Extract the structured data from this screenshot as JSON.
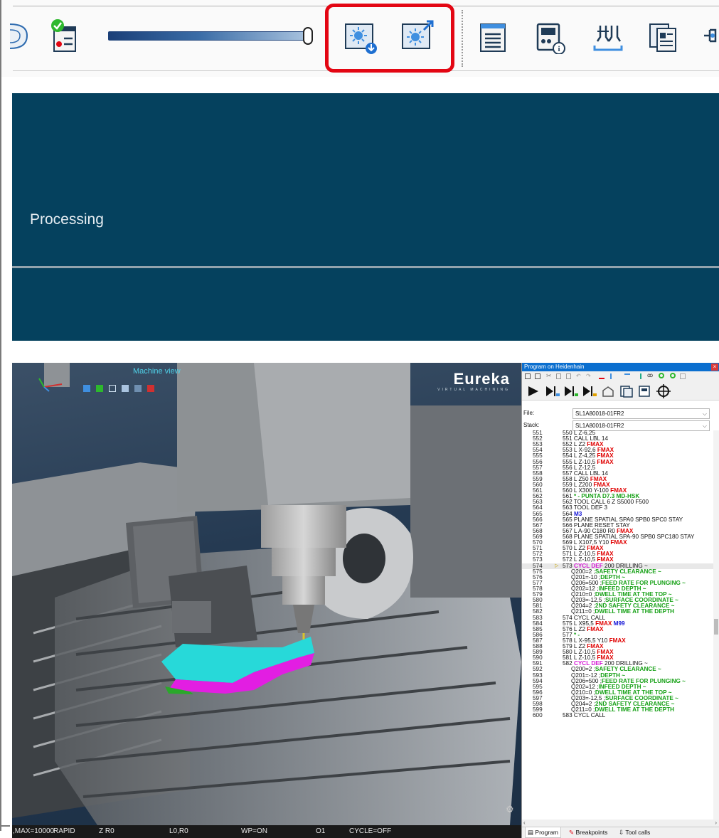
{
  "toolbar": {
    "icons": [
      "disc-icon",
      "report-check-icon",
      "light-download-icon",
      "light-export-icon",
      "document-list-icon",
      "machine-info-icon",
      "collision-icon",
      "pages-icon",
      "tool-icon"
    ],
    "slider_level": 0.97
  },
  "processing": {
    "label": "Processing"
  },
  "viewport": {
    "title": "Machine view",
    "logo": "Eureka",
    "logo_sub": "VIRTUAL MACHINING"
  },
  "status": {
    "fields": [
      ",MAX=10000",
      "RAPID",
      "Z R0",
      "L0,R0",
      "WP=ON",
      "O1",
      "CYCLE=OFF"
    ]
  },
  "program": {
    "title": "Program on Heidenhain",
    "file_label": "File:",
    "file_value": "SL1A80018-01FR2",
    "stack_label": "Stack:",
    "stack_value": "SL1A80018-01FR2",
    "tabs": [
      "Program",
      "Breakpoints",
      "Tool calls"
    ],
    "lines": [
      {
        "n": "551",
        "t": "550 L Z-6,25"
      },
      {
        "n": "552",
        "t": "551 CALL LBL 14"
      },
      {
        "n": "553",
        "t": "552 L Z2 ",
        "k": "FMAX",
        "kc": "red"
      },
      {
        "n": "554",
        "t": "553 L X-92,6 ",
        "k": "FMAX",
        "kc": "red"
      },
      {
        "n": "555",
        "t": "554 L Z-4,25 ",
        "k": "FMAX",
        "kc": "red"
      },
      {
        "n": "556",
        "t": "555 L Z-10,5 ",
        "k": "FMAX",
        "kc": "red"
      },
      {
        "n": "557",
        "t": "556 L Z-12,5"
      },
      {
        "n": "558",
        "t": "557 CALL LBL 14"
      },
      {
        "n": "559",
        "t": "558 L Z50 ",
        "k": "FMAX",
        "kc": "red"
      },
      {
        "n": "560",
        "t": "559 L Z200 ",
        "k": "FMAX",
        "kc": "red"
      },
      {
        "n": "561",
        "t": "560 L X300 Y-100 ",
        "k": "FMAX",
        "kc": "red"
      },
      {
        "n": "562",
        "t": "561 ",
        "k": "* - PUNTA D7.3 MD-HSK",
        "kc": "green"
      },
      {
        "n": "563",
        "t": "562 TOOL CALL 6 Z S5000 F500"
      },
      {
        "n": "564",
        "t": "563 TOOL DEF 3"
      },
      {
        "n": "565",
        "t": "564 ",
        "k": "M3",
        "kc": "blue"
      },
      {
        "n": "566",
        "t": "565 PLANE SPATIAL SPA0 SPB0 SPC0 STAY"
      },
      {
        "n": "567",
        "t": "566 PLANE RESET STAY"
      },
      {
        "n": "568",
        "t": "567 L A-90 C180 R0 ",
        "k": "FMAX",
        "kc": "red"
      },
      {
        "n": "569",
        "t": "568 PLANE SPATIAL SPA-90 SPB0 SPC180 STAY"
      },
      {
        "n": "570",
        "t": "569 L X107,5 Y10 ",
        "k": "FMAX",
        "kc": "red"
      },
      {
        "n": "571",
        "t": "570 L Z2 ",
        "k": "FMAX",
        "kc": "red"
      },
      {
        "n": "572",
        "t": "571 L Z-10,5 ",
        "k": "FMAX",
        "kc": "red"
      },
      {
        "n": "573",
        "t": "572 L Z-10,5 ",
        "k": "FMAX",
        "kc": "red"
      },
      {
        "n": "574",
        "t": "573 ",
        "k": "CYCL DEF",
        "kc": "mag",
        "t2": " 200 DRILLING ~",
        "cur": true
      },
      {
        "n": "575",
        "t": "Q200=2 ;",
        "k": "SAFETY CLEARANCE ~",
        "kc": "green",
        "ind": true
      },
      {
        "n": "576",
        "t": "Q201=-10 ;",
        "k": "DEPTH ~",
        "kc": "green",
        "ind": true
      },
      {
        "n": "577",
        "t": "Q206=500 ;",
        "k": "FEED RATE FOR PLUNGING ~",
        "kc": "green",
        "ind": true
      },
      {
        "n": "578",
        "t": "Q202=12 ;",
        "k": "INFEED DEPTH ~",
        "kc": "green",
        "ind": true
      },
      {
        "n": "579",
        "t": "Q210=0 ;",
        "k": "DWELL TIME AT THE TOP ~",
        "kc": "green",
        "ind": true
      },
      {
        "n": "580",
        "t": "Q203=-12,5 ;",
        "k": "SURFACE COORDINATE ~",
        "kc": "green",
        "ind": true
      },
      {
        "n": "581",
        "t": "Q204=2 ;",
        "k": "2ND SAFETY CLEARANCE ~",
        "kc": "green",
        "ind": true
      },
      {
        "n": "582",
        "t": "Q211=0 ;",
        "k": "DWELL TIME AT THE DEPTH",
        "kc": "green",
        "ind": true
      },
      {
        "n": "583",
        "t": "574 CYCL CALL"
      },
      {
        "n": "584",
        "t": "575 L X95,5 ",
        "k": "FMAX",
        "kc": "red",
        "t2": " ",
        "k2": "M99",
        "kc2": "blue"
      },
      {
        "n": "585",
        "t": "576 L Z2 ",
        "k": "FMAX",
        "kc": "red"
      },
      {
        "n": "586",
        "t": "577 ",
        "k": "* - ",
        "kc": "green"
      },
      {
        "n": "587",
        "t": "578 L X-95,5 Y10 ",
        "k": "FMAX",
        "kc": "red"
      },
      {
        "n": "588",
        "t": "579 L Z2 ",
        "k": "FMAX",
        "kc": "red"
      },
      {
        "n": "589",
        "t": "580 L Z-10,5 ",
        "k": "FMAX",
        "kc": "red"
      },
      {
        "n": "590",
        "t": "581 L Z-10,5 ",
        "k": "FMAX",
        "kc": "red"
      },
      {
        "n": "591",
        "t": "582 ",
        "k": "CYCL DEF",
        "kc": "mag",
        "t2": " 200 DRILLING ~"
      },
      {
        "n": "592",
        "t": "Q200=2 ;",
        "k": "SAFETY CLEARANCE ~",
        "kc": "green",
        "ind": true
      },
      {
        "n": "593",
        "t": "Q201=-12 ;",
        "k": "DEPTH ~",
        "kc": "green",
        "ind": true
      },
      {
        "n": "594",
        "t": "Q206=500 ;",
        "k": "FEED RATE FOR PLUNGING ~",
        "kc": "green",
        "ind": true
      },
      {
        "n": "595",
        "t": "Q202=12 ;",
        "k": "INFEED DEPTH ~",
        "kc": "green",
        "ind": true
      },
      {
        "n": "596",
        "t": "Q210=0 ;",
        "k": "DWELL TIME AT THE TOP ~",
        "kc": "green",
        "ind": true
      },
      {
        "n": "597",
        "t": "Q203=-12,5 ;",
        "k": "SURFACE COORDINATE ~",
        "kc": "green",
        "ind": true
      },
      {
        "n": "598",
        "t": "Q204=2 ;",
        "k": "2ND SAFETY CLEARANCE ~",
        "kc": "green",
        "ind": true
      },
      {
        "n": "599",
        "t": "Q211=0 ;",
        "k": "DWELL TIME AT THE DEPTH",
        "kc": "green",
        "ind": true
      },
      {
        "n": "600",
        "t": "583 CYCL CALL"
      }
    ]
  },
  "colors": {
    "processing_bg": "#05415e",
    "highlight": "#e30613",
    "title_bar": "#0b6fcf",
    "fmax": "#e00000",
    "comment": "#17a117",
    "cycle": "#d517d5",
    "mfunc": "#1515d6",
    "part_cyan": "#27d9d9",
    "part_magenta": "#e21ee2"
  }
}
